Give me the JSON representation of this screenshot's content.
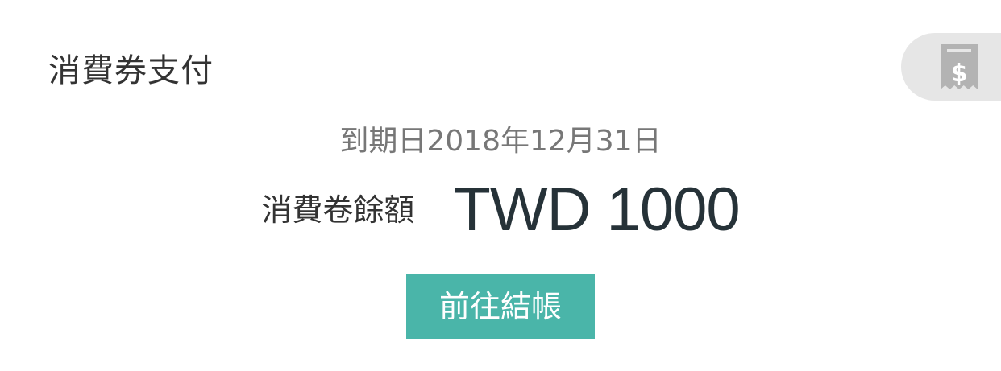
{
  "header": {
    "title": "消費券支付",
    "voucher_icon": "receipt-dollar-icon"
  },
  "voucher": {
    "expiry_text": "到期日2018年12月31日",
    "balance_label": "消費卷餘額",
    "balance_amount": "TWD 1000"
  },
  "actions": {
    "checkout_label": "前往結帳"
  },
  "colors": {
    "accent": "#4ab5a9",
    "tab_background": "#e6e6e6",
    "icon_gray": "#b3b3b3",
    "text_dark": "#263238"
  }
}
